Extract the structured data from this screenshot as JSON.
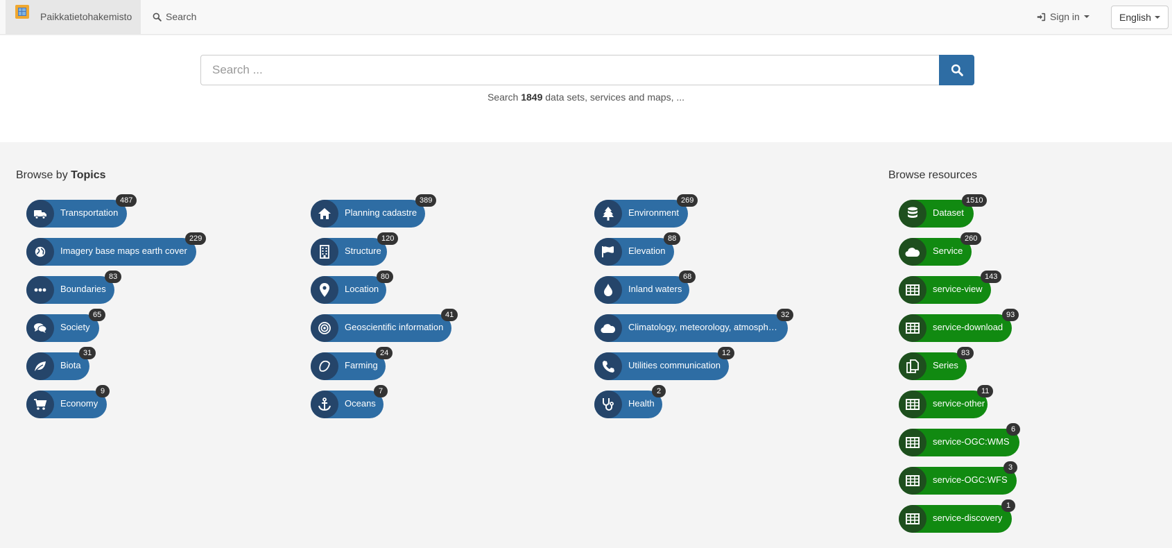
{
  "navbar": {
    "brand": "Paikkatietohakemisto",
    "search_label": "Search",
    "signin_label": "Sign in",
    "language": "English"
  },
  "search": {
    "placeholder": "Search ...",
    "hint_prefix": "Search",
    "count": "1849",
    "hint_suffix": "data sets, services and maps, ..."
  },
  "topics": {
    "title_prefix": "Browse by",
    "title_bold": "Topics",
    "items": [
      {
        "label": "Transportation",
        "count": "487",
        "icon": "truck-icon"
      },
      {
        "label": "Imagery base maps earth cover",
        "count": "229",
        "icon": "globe-icon"
      },
      {
        "label": "Boundaries",
        "count": "83",
        "icon": "ellipsis-icon"
      },
      {
        "label": "Society",
        "count": "65",
        "icon": "comments-icon"
      },
      {
        "label": "Biota",
        "count": "31",
        "icon": "leaf-icon"
      },
      {
        "label": "Economy",
        "count": "9",
        "icon": "cart-icon"
      },
      {
        "label": "Planning cadastre",
        "count": "389",
        "icon": "home-icon"
      },
      {
        "label": "Structure",
        "count": "120",
        "icon": "building-icon"
      },
      {
        "label": "Location",
        "count": "80",
        "icon": "map-marker-icon"
      },
      {
        "label": "Geoscientific information",
        "count": "41",
        "icon": "bullseye-icon"
      },
      {
        "label": "Farming",
        "count": "24",
        "icon": "lemon-icon"
      },
      {
        "label": "Oceans",
        "count": "7",
        "icon": "anchor-icon"
      },
      {
        "label": "Environment",
        "count": "269",
        "icon": "tree-icon"
      },
      {
        "label": "Elevation",
        "count": "88",
        "icon": "flag-icon"
      },
      {
        "label": "Inland waters",
        "count": "68",
        "icon": "tint-icon"
      },
      {
        "label": "Climatology, meteorology, atmosph…",
        "count": "32",
        "icon": "cloud-icon"
      },
      {
        "label": "Utilities communication",
        "count": "12",
        "icon": "phone-icon"
      },
      {
        "label": "Health",
        "count": "2",
        "icon": "stethoscope-icon"
      }
    ]
  },
  "resources": {
    "title": "Browse resources",
    "items": [
      {
        "label": "Dataset",
        "count": "1510",
        "icon": "database-icon"
      },
      {
        "label": "Service",
        "count": "260",
        "icon": "cloud-icon"
      },
      {
        "label": "service-view",
        "count": "143",
        "icon": "table-icon"
      },
      {
        "label": "service-download",
        "count": "93",
        "icon": "table-icon"
      },
      {
        "label": "Series",
        "count": "83",
        "icon": "copy-icon"
      },
      {
        "label": "service-other",
        "count": "11",
        "icon": "table-icon"
      },
      {
        "label": "service-OGC:WMS",
        "count": "6",
        "icon": "table-icon"
      },
      {
        "label": "service-OGC:WFS",
        "count": "3",
        "icon": "table-icon"
      },
      {
        "label": "service-discovery",
        "count": "1",
        "icon": "table-icon"
      }
    ]
  },
  "colors": {
    "topic_chip": "#2e6da4",
    "resource_chip": "#118a11",
    "badge": "#333333"
  }
}
